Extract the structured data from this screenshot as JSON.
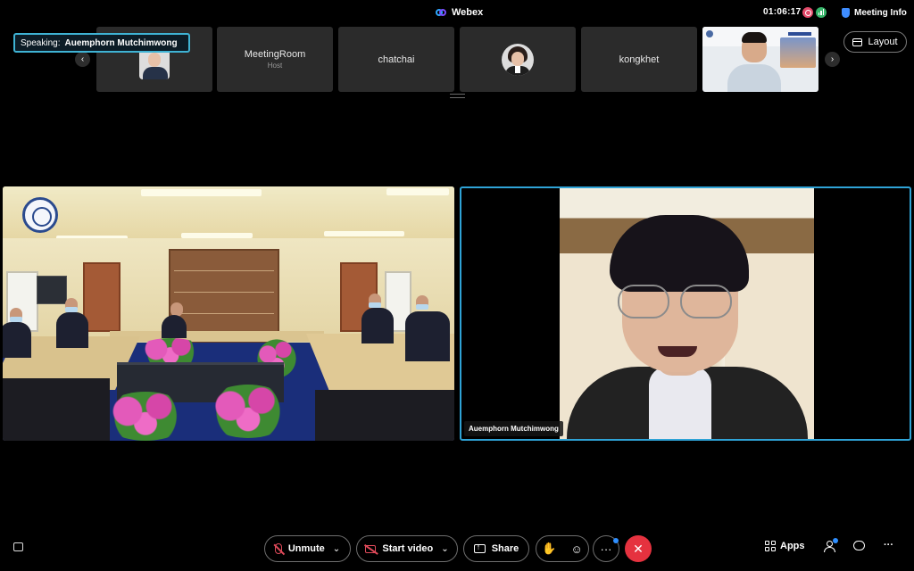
{
  "app": {
    "title": "Webex"
  },
  "header": {
    "timer": "01:06:17",
    "meeting_info_label": "Meeting Info"
  },
  "speaking": {
    "prefix": "Speaking:",
    "name": "Auemphorn Mutchimwong"
  },
  "filmstrip": {
    "tiles": [
      {
        "name": "MeetingRoom",
        "role": "Host"
      },
      {
        "name": "chatchai"
      },
      {
        "name": "kongkhet"
      }
    ]
  },
  "layout_button": {
    "label": "Layout"
  },
  "main": {
    "speaker_name": "Auemphorn Mutchimwong"
  },
  "controls": {
    "unmute_label": "Unmute",
    "start_video_label": "Start video",
    "share_label": "Share",
    "more_label": "···",
    "end_label": "✕",
    "apps_label": "Apps",
    "overflow_label": "···"
  },
  "colors": {
    "accent": "#2fa3d6",
    "end_call": "#e5323f",
    "muted": "#e04a5a",
    "recording": "#e34a6a"
  },
  "icons": [
    "webex-icon",
    "record-icon",
    "network-icon",
    "shield-icon",
    "layout-icon",
    "mic-off-icon",
    "camera-off-icon",
    "share-icon",
    "hand-icon",
    "reaction-icon",
    "more-icon",
    "end-call-icon",
    "apps-icon",
    "participants-icon",
    "chat-icon",
    "caption-icon",
    "chevron-left-icon",
    "chevron-right-icon"
  ]
}
